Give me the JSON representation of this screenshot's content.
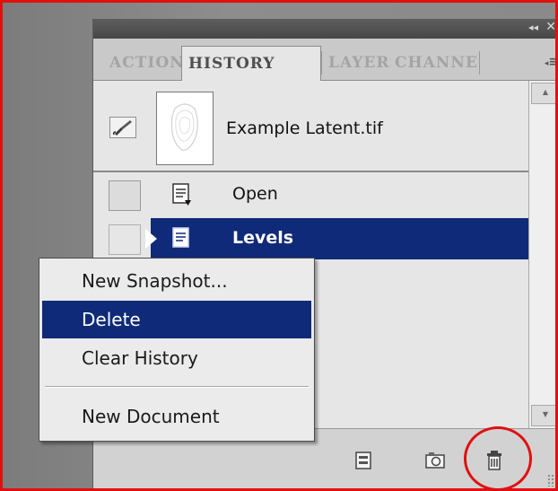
{
  "panel": {
    "titlebar": {
      "collapse_glyph": "◂◂",
      "close_glyph": "✕"
    },
    "tabs": [
      {
        "label": "ACTIONS",
        "active": false
      },
      {
        "label": "HISTORY",
        "active": true
      },
      {
        "label": "LAYERS",
        "active": false
      },
      {
        "label": "CHANNELS",
        "active": false
      }
    ],
    "menu_glyph": "≡"
  },
  "snapshot": {
    "name": "Example Latent.tif",
    "icon": "brush-icon"
  },
  "history_states": [
    {
      "label": "Open",
      "icon": "document-icon",
      "selected": false
    },
    {
      "label": "Levels",
      "icon": "document-icon",
      "selected": true
    }
  ],
  "context_menu": {
    "items": [
      {
        "label": "New Snapshot...",
        "selected": false
      },
      {
        "label": "Delete",
        "selected": true
      },
      {
        "label": "Clear History",
        "selected": false
      },
      {
        "label": "New Document",
        "selected": false
      }
    ]
  },
  "bottom_bar": {
    "icons": [
      "new-document-from-state-icon",
      "camera-snapshot-icon",
      "trash-icon"
    ]
  },
  "colors": {
    "selection": "#0f2a78",
    "annotation": "#e01010",
    "panel_bg": "#e6e6e6",
    "titlebar": "#474747"
  }
}
